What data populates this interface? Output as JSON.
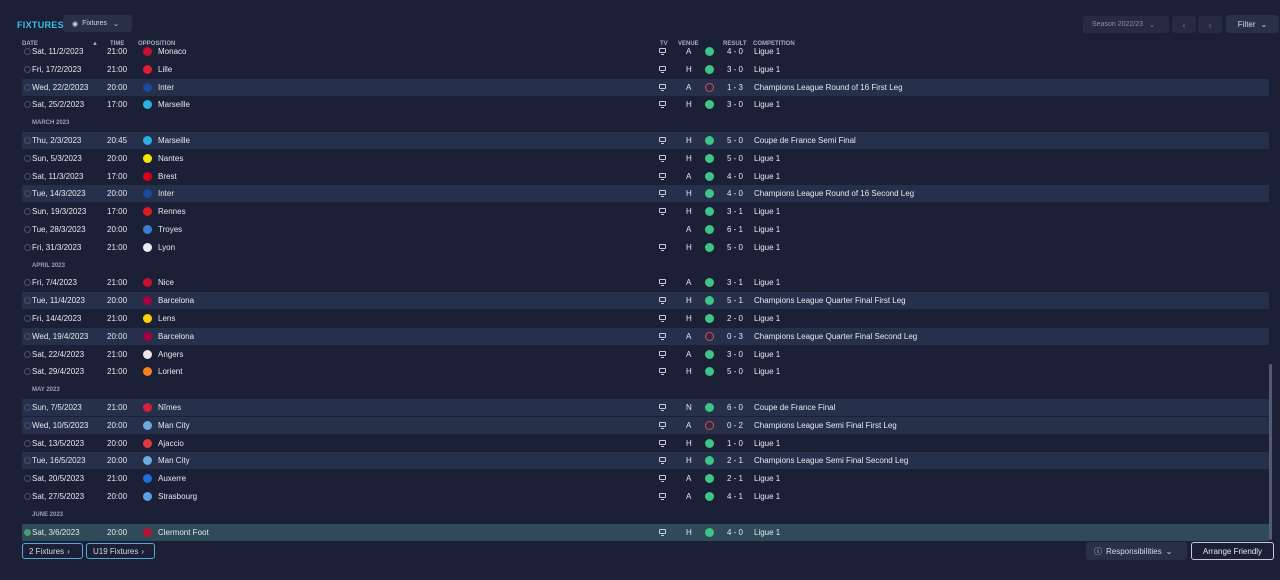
{
  "header": {
    "title": "FIXTURES",
    "view_dropdown": "Fixtures",
    "season": "Season 2022/23",
    "filter": "Filter"
  },
  "columns": {
    "date": "DATE",
    "time": "TIME",
    "opposition": "OPPOSITION",
    "tv": "TV",
    "venue": "VENUE",
    "result": "RESULT",
    "competition": "COMPETITION"
  },
  "rows": [
    {
      "kind": "match",
      "date": "Sat, 11/2/2023",
      "time": "21:00",
      "team": "Monaco",
      "crest": "#c8102e",
      "tv": true,
      "venue": "A",
      "outcome": "W",
      "score": "4 - 0",
      "competition": "Ligue 1",
      "style": "plain"
    },
    {
      "kind": "match",
      "date": "Fri, 17/2/2023",
      "time": "21:00",
      "team": "Lille",
      "crest": "#e01e37",
      "tv": true,
      "venue": "H",
      "outcome": "W",
      "score": "3 - 0",
      "competition": "Ligue 1",
      "style": "plain"
    },
    {
      "kind": "match",
      "date": "Wed, 22/2/2023",
      "time": "20:00",
      "team": "Inter",
      "crest": "#1a4a9c",
      "tv": true,
      "venue": "A",
      "outcome": "L",
      "score": "1 - 3",
      "competition": "Champions League Round of 16  First Leg",
      "style": "alt"
    },
    {
      "kind": "match",
      "date": "Sat, 25/2/2023",
      "time": "17:00",
      "team": "Marseille",
      "crest": "#2faee0",
      "tv": true,
      "venue": "H",
      "outcome": "W",
      "score": "3 - 0",
      "competition": "Ligue 1",
      "style": "plain"
    },
    {
      "kind": "month",
      "label": "MARCH 2023"
    },
    {
      "kind": "match",
      "date": "Thu, 2/3/2023",
      "time": "20:45",
      "team": "Marseille",
      "crest": "#2faee0",
      "tv": true,
      "venue": "H",
      "outcome": "W",
      "score": "5 - 0",
      "competition": "Coupe de France Semi Final",
      "style": "alt"
    },
    {
      "kind": "match",
      "date": "Sun, 5/3/2023",
      "time": "20:00",
      "team": "Nantes",
      "crest": "#f5e600",
      "tv": true,
      "venue": "H",
      "outcome": "W",
      "score": "5 - 0",
      "competition": "Ligue 1",
      "style": "plain"
    },
    {
      "kind": "match",
      "date": "Sat, 11/3/2023",
      "time": "17:00",
      "team": "Brest",
      "crest": "#e1001a",
      "tv": true,
      "venue": "A",
      "outcome": "W",
      "score": "4 - 0",
      "competition": "Ligue 1",
      "style": "plain"
    },
    {
      "kind": "match",
      "date": "Tue, 14/3/2023",
      "time": "20:00",
      "team": "Inter",
      "crest": "#1a4a9c",
      "tv": true,
      "venue": "H",
      "outcome": "W",
      "score": "4 - 0",
      "competition": "Champions League Round of 16  Second Leg",
      "style": "alt"
    },
    {
      "kind": "match",
      "date": "Sun, 19/3/2023",
      "time": "17:00",
      "team": "Rennes",
      "crest": "#d81e1e",
      "tv": true,
      "venue": "H",
      "outcome": "W",
      "score": "3 - 1",
      "competition": "Ligue 1",
      "style": "plain"
    },
    {
      "kind": "match",
      "date": "Tue, 28/3/2023",
      "time": "20:00",
      "team": "Troyes",
      "crest": "#3b7fd0",
      "tv": false,
      "venue": "A",
      "outcome": "W",
      "score": "6 - 1",
      "competition": "Ligue 1",
      "style": "plain"
    },
    {
      "kind": "match",
      "date": "Fri, 31/3/2023",
      "time": "21:00",
      "team": "Lyon",
      "crest": "#e8eef8",
      "tv": true,
      "venue": "H",
      "outcome": "W",
      "score": "5 - 0",
      "competition": "Ligue 1",
      "style": "plain"
    },
    {
      "kind": "month",
      "label": "APRIL 2023"
    },
    {
      "kind": "match",
      "date": "Fri, 7/4/2023",
      "time": "21:00",
      "team": "Nice",
      "crest": "#c8102e",
      "tv": true,
      "venue": "A",
      "outcome": "W",
      "score": "3 - 1",
      "competition": "Ligue 1",
      "style": "plain"
    },
    {
      "kind": "match",
      "date": "Tue, 11/4/2023",
      "time": "20:00",
      "team": "Barcelona",
      "crest": "#a50044",
      "tv": true,
      "venue": "H",
      "outcome": "W",
      "score": "5 - 1",
      "competition": "Champions League Quarter Final First Leg",
      "style": "alt"
    },
    {
      "kind": "match",
      "date": "Fri, 14/4/2023",
      "time": "21:00",
      "team": "Lens",
      "crest": "#ffd100",
      "tv": true,
      "venue": "H",
      "outcome": "W",
      "score": "2 - 0",
      "competition": "Ligue 1",
      "style": "plain"
    },
    {
      "kind": "match",
      "date": "Wed, 19/4/2023",
      "time": "20:00",
      "team": "Barcelona",
      "crest": "#a50044",
      "tv": true,
      "venue": "A",
      "outcome": "L",
      "score": "0 - 3",
      "competition": "Champions League Quarter Final Second Leg",
      "style": "alt"
    },
    {
      "kind": "match",
      "date": "Sat, 22/4/2023",
      "time": "21:00",
      "team": "Angers",
      "crest": "#e8e8e8",
      "tv": true,
      "venue": "A",
      "outcome": "W",
      "score": "3 - 0",
      "competition": "Ligue 1",
      "style": "plain"
    },
    {
      "kind": "match",
      "date": "Sat, 29/4/2023",
      "time": "21:00",
      "team": "Lorient",
      "crest": "#f58220",
      "tv": true,
      "venue": "H",
      "outcome": "W",
      "score": "5 - 0",
      "competition": "Ligue 1",
      "style": "plain"
    },
    {
      "kind": "month",
      "label": "MAY 2023"
    },
    {
      "kind": "match",
      "date": "Sun, 7/5/2023",
      "time": "21:00",
      "team": "Nîmes",
      "crest": "#d4213d",
      "tv": true,
      "venue": "N",
      "outcome": "W",
      "score": "6 - 0",
      "competition": "Coupe de France Final",
      "style": "alt"
    },
    {
      "kind": "match",
      "date": "Wed, 10/5/2023",
      "time": "20:00",
      "team": "Man City",
      "crest": "#6cabdd",
      "tv": true,
      "venue": "A",
      "outcome": "L",
      "score": "0 - 2",
      "competition": "Champions League Semi Final First Leg",
      "style": "alt"
    },
    {
      "kind": "match",
      "date": "Sat, 13/5/2023",
      "time": "20:00",
      "team": "Ajaccio",
      "crest": "#e03a3e",
      "tv": true,
      "venue": "H",
      "outcome": "W",
      "score": "1 - 0",
      "competition": "Ligue 1",
      "style": "plain"
    },
    {
      "kind": "match",
      "date": "Tue, 16/5/2023",
      "time": "20:00",
      "team": "Man City",
      "crest": "#6cabdd",
      "tv": true,
      "venue": "H",
      "outcome": "W",
      "score": "2 - 1",
      "competition": "Champions League Semi Final Second Leg",
      "style": "alt"
    },
    {
      "kind": "match",
      "date": "Sat, 20/5/2023",
      "time": "21:00",
      "team": "Auxerre",
      "crest": "#1e6fd9",
      "tv": true,
      "venue": "A",
      "outcome": "W",
      "score": "2 - 1",
      "competition": "Ligue 1",
      "style": "plain"
    },
    {
      "kind": "match",
      "date": "Sat, 27/5/2023",
      "time": "20:00",
      "team": "Strasbourg",
      "crest": "#5aa0e6",
      "tv": true,
      "venue": "A",
      "outcome": "W",
      "score": "4 - 1",
      "competition": "Ligue 1",
      "style": "plain"
    },
    {
      "kind": "month",
      "label": "JUNE 2023"
    },
    {
      "kind": "match",
      "date": "Sat, 3/6/2023",
      "time": "20:00",
      "team": "Clermont Foot",
      "crest": "#b3122e",
      "tv": true,
      "venue": "H",
      "outcome": "W",
      "score": "4 - 0",
      "competition": "Ligue 1",
      "style": "hl",
      "checked": true
    }
  ],
  "footer": {
    "fixtures_link": "2 Fixtures",
    "u19_link": "U19 Fixtures",
    "responsibilities": "Responsibilities",
    "arrange_friendly": "Arrange Friendly"
  }
}
